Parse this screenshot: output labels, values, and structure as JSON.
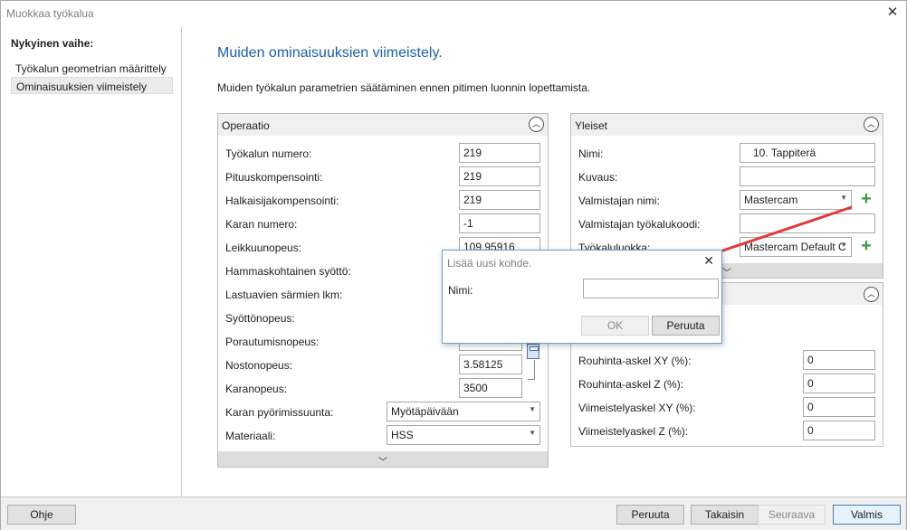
{
  "window": {
    "title": "Muokkaa työkalua",
    "close_glyph": "✕"
  },
  "sidebar": {
    "heading": "Nykyinen vaihe:",
    "items": [
      {
        "label": "Työkalun geometrian määrittely",
        "selected": false
      },
      {
        "label": "Ominaisuuksien viimeistely",
        "selected": true
      }
    ]
  },
  "main": {
    "heading": "Muiden ominaisuuksien viimeistely.",
    "description": "Muiden työkalun parametrien säätäminen ennen pitimen luonnin lopettamista."
  },
  "operaatio": {
    "title": "Operaatio",
    "fields": [
      {
        "label": "Työkalun numero:",
        "value": "219"
      },
      {
        "label": "Pituuskompensointi:",
        "value": "219"
      },
      {
        "label": "Halkaisijakompensointi:",
        "value": "219"
      },
      {
        "label": "Karan numero:",
        "value": "-1"
      },
      {
        "label": "Leikkuunopeus:",
        "value": "109.95916"
      },
      {
        "label": "Hammaskohtainen syöttö:",
        "value": ""
      },
      {
        "label": "Lastuavien särmien lkm:",
        "value": ""
      },
      {
        "label": "Syöttönopeus:",
        "value": ""
      },
      {
        "label": "Porautumisnopeus:",
        "value": ""
      },
      {
        "label": "Nostonopeus:",
        "value": "3.58125"
      },
      {
        "label": "Karanopeus:",
        "value": "3500"
      }
    ],
    "spindle_direction": {
      "label": "Karan pyörimissuunta:",
      "value": "Myötäpäivään"
    },
    "material": {
      "label": "Materiaali:",
      "value": "HSS"
    }
  },
  "yleiset": {
    "title": "Yleiset",
    "name": {
      "label": "Nimi:",
      "value": "10. Tappiterä"
    },
    "description": {
      "label": "Kuvaus:",
      "value": ""
    },
    "manufacturer": {
      "label": "Valmistajan nimi:",
      "value": "Mastercam"
    },
    "manufacturer_code": {
      "label": "Valmistajan työkalukoodi:",
      "value": ""
    },
    "tool_class": {
      "label": "Työkaluluokka:",
      "value": "Mastercam Default C"
    }
  },
  "steps_panel": {
    "fields": [
      {
        "label": "Rouhinta-askel XY (%):",
        "value": "0"
      },
      {
        "label": "Rouhinta-askel Z (%):",
        "value": "0"
      },
      {
        "label": "Viimeistelyaskel XY (%):",
        "value": "0"
      },
      {
        "label": "Viimeistelyaskel Z (%):",
        "value": "0"
      }
    ]
  },
  "dialog": {
    "title": "Lisää uusi kohde.",
    "name_label": "Nimi:",
    "name_value": "",
    "ok_label": "OK",
    "cancel_label": "Peruuta",
    "close_glyph": "✕"
  },
  "footer": {
    "help": "Ohje",
    "cancel": "Peruuta",
    "back": "Takaisin",
    "next": "Seuraava",
    "finish": "Valmis"
  },
  "colors": {
    "heading": "#1c5fa8",
    "arrow": "#e0393b",
    "plus": "#3d9a3d"
  },
  "icons": {
    "collapse": "chevron-up-icon",
    "expand": "chevron-down-icon",
    "add": "plus-icon",
    "calculator": "calculator-icon"
  }
}
